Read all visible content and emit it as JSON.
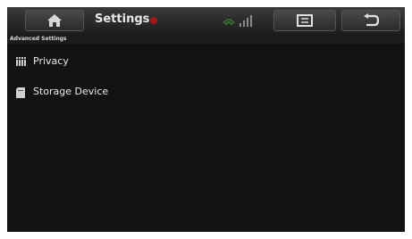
{
  "header": {
    "title": "Settings"
  },
  "section": {
    "title": "Advanced Settings"
  },
  "items": [
    {
      "label": "Privacy",
      "icon": "privacy-bars-icon"
    },
    {
      "label": "Storage Device",
      "icon": "storage-card-icon"
    }
  ],
  "colors": {
    "background": "#131313",
    "topbar": "#2a2a2a",
    "recording": "#a01818",
    "signal": "#3a8a3a"
  }
}
